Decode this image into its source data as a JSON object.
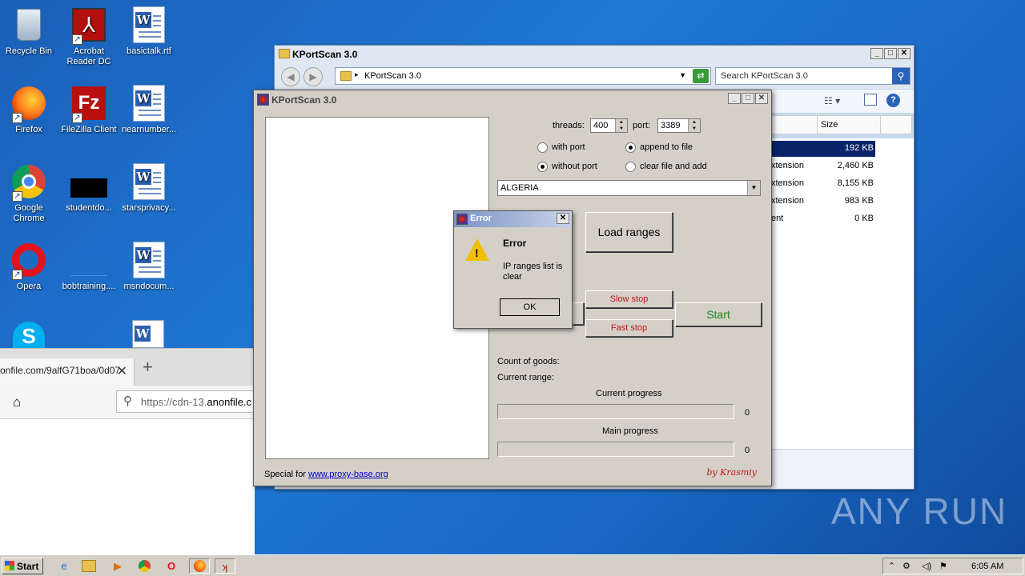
{
  "desktop": {
    "icons": [
      {
        "label": "Recycle Bin"
      },
      {
        "label": "Acrobat Reader DC"
      },
      {
        "label": "basictalk.rtf"
      },
      {
        "label": "Firefox"
      },
      {
        "label": "FileZilla Client"
      },
      {
        "label": "nearnumber..."
      },
      {
        "label": "Google Chrome"
      },
      {
        "label": "studentdo..."
      },
      {
        "label": "starsprivacy..."
      },
      {
        "label": "Opera"
      },
      {
        "label": "bobtraining...."
      },
      {
        "label": "msndocum..."
      }
    ]
  },
  "browser": {
    "tab_title": "onfile.com/9alfG71boa/0d07",
    "url_prefix": "https://cdn-13.",
    "url_domain": "anonfile.c"
  },
  "explorer": {
    "title": "KPortScan 3.0",
    "address": "KPortScan 3.0",
    "search_placeholder": "Search KPortScan 3.0",
    "col_size": "Size",
    "rows": [
      {
        "type": "",
        "size": "192 KB"
      },
      {
        "type": "xtension",
        "size": "2,460 KB"
      },
      {
        "type": "xtension",
        "size": "8,155 KB"
      },
      {
        "type": "xtension",
        "size": "983 KB"
      },
      {
        "type": "ent",
        "size": "0 KB"
      }
    ]
  },
  "kportscan": {
    "title": "KPortScan 3.0",
    "threads_label": "threads:",
    "threads_value": "400",
    "port_label": "port:",
    "port_value": "3389",
    "radio_with_port": "with port",
    "radio_without_port": "without port",
    "radio_append": "append to file",
    "radio_clear": "clear file and add",
    "country": "ALGERIA",
    "load_ranges": "Load ranges",
    "slow_stop": "Slow stop",
    "fast_stop": "Fast stop",
    "start": "Start",
    "count_goods": "Count of goods:",
    "current_range": "Current range:",
    "current_progress_label": "Current progress",
    "current_progress_value": "0",
    "main_progress_label": "Main progress",
    "main_progress_value": "0",
    "special_for": "Special for",
    "link": "www.proxy-base.org",
    "signature": "by Krasmiy"
  },
  "error_dialog": {
    "title": "Error",
    "heading": "Error",
    "message": "IP ranges list is clear",
    "ok": "OK"
  },
  "taskbar": {
    "start": "Start",
    "clock": "6:05 AM"
  },
  "watermark": "ANY RUN"
}
